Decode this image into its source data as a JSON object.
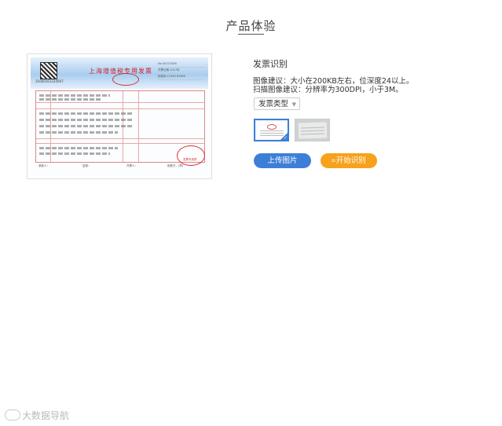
{
  "section": {
    "title": "产品体验"
  },
  "invoice": {
    "title": "上海增值税专用发票",
    "qr_code_number": "31000161234567",
    "meta_lines": [
      "No 00123456",
      "开票日期 2017年",
      "校验码 12345 67890"
    ],
    "stamp_text": "发票专用章",
    "footer_items": [
      "收款人：",
      "复核：",
      "开票人：",
      "销售方：(章)"
    ]
  },
  "panel": {
    "title": "发票识别",
    "tip_image": "图像建议：大小在200KB左右，位深度24以上。",
    "tip_scan": "扫描图像建议：分辨率为300DPI，小于3M。",
    "type_select": {
      "selected": "发票类型"
    },
    "samples": [
      {
        "name": "sample-invoice-1",
        "selected": true
      },
      {
        "name": "sample-invoice-2",
        "selected": false
      }
    ],
    "upload_label": "上传图片",
    "start_label": "开始识别",
    "accent_blue": "#3d7fd6",
    "accent_orange": "#f7a21c"
  },
  "watermark": {
    "text": "大数据导航"
  }
}
